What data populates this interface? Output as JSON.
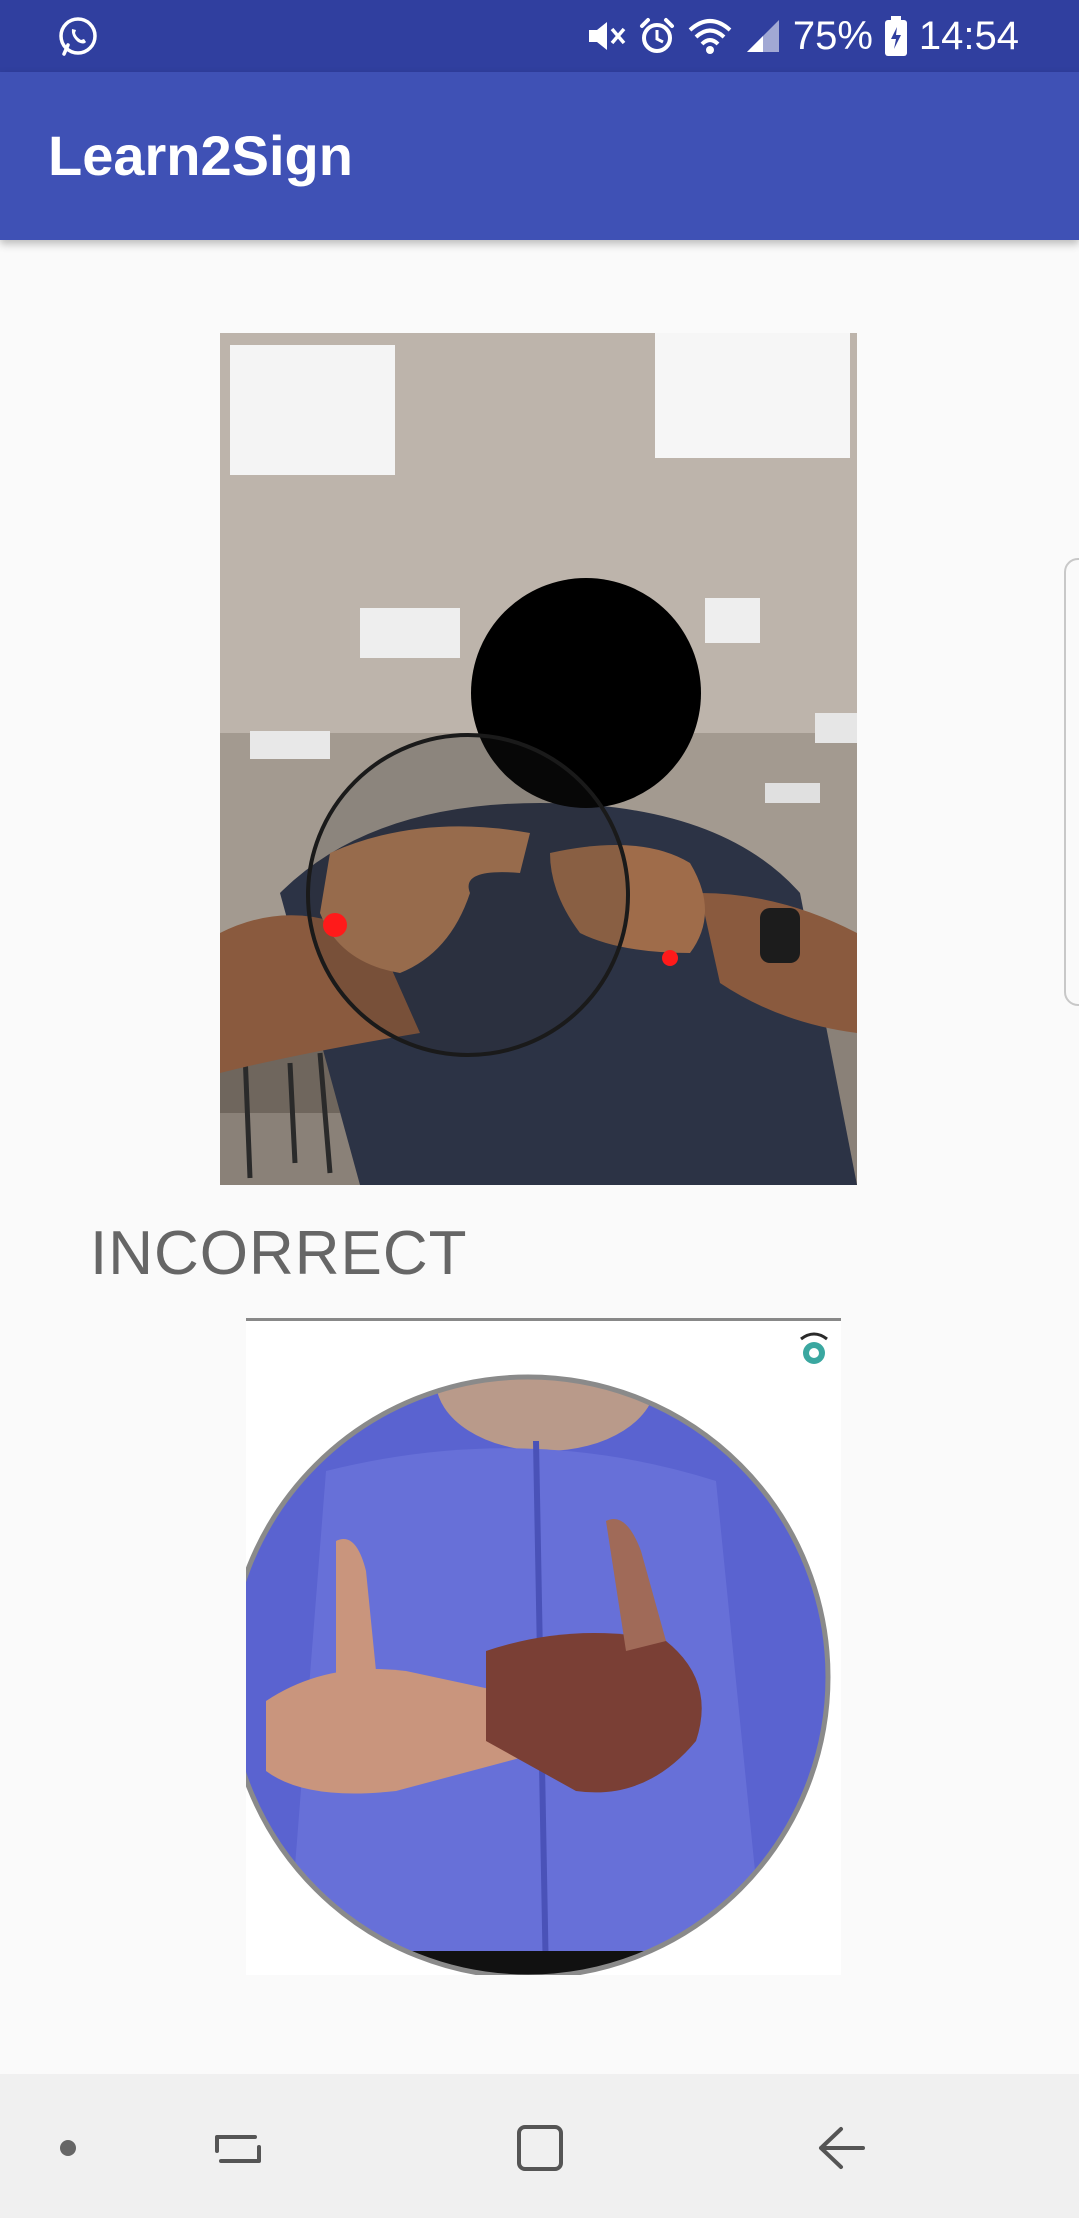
{
  "status_bar": {
    "battery_percent": "75%",
    "time": "14:54",
    "icons": [
      "whatsapp-icon",
      "mute-icon",
      "alarm-icon",
      "wifi-icon",
      "signal-icon",
      "battery-icon"
    ]
  },
  "app_bar": {
    "title": "Learn2Sign"
  },
  "main": {
    "result_text": "INCORRECT"
  },
  "nav_bar": {
    "icons": [
      "dot-icon",
      "recents-icon",
      "home-icon",
      "back-icon"
    ]
  },
  "colors": {
    "status_bar": "#303f9f",
    "app_bar": "#3f51b5",
    "background": "#fafafa",
    "result_text": "#666666",
    "nav_bar": "#f0f0f0"
  }
}
